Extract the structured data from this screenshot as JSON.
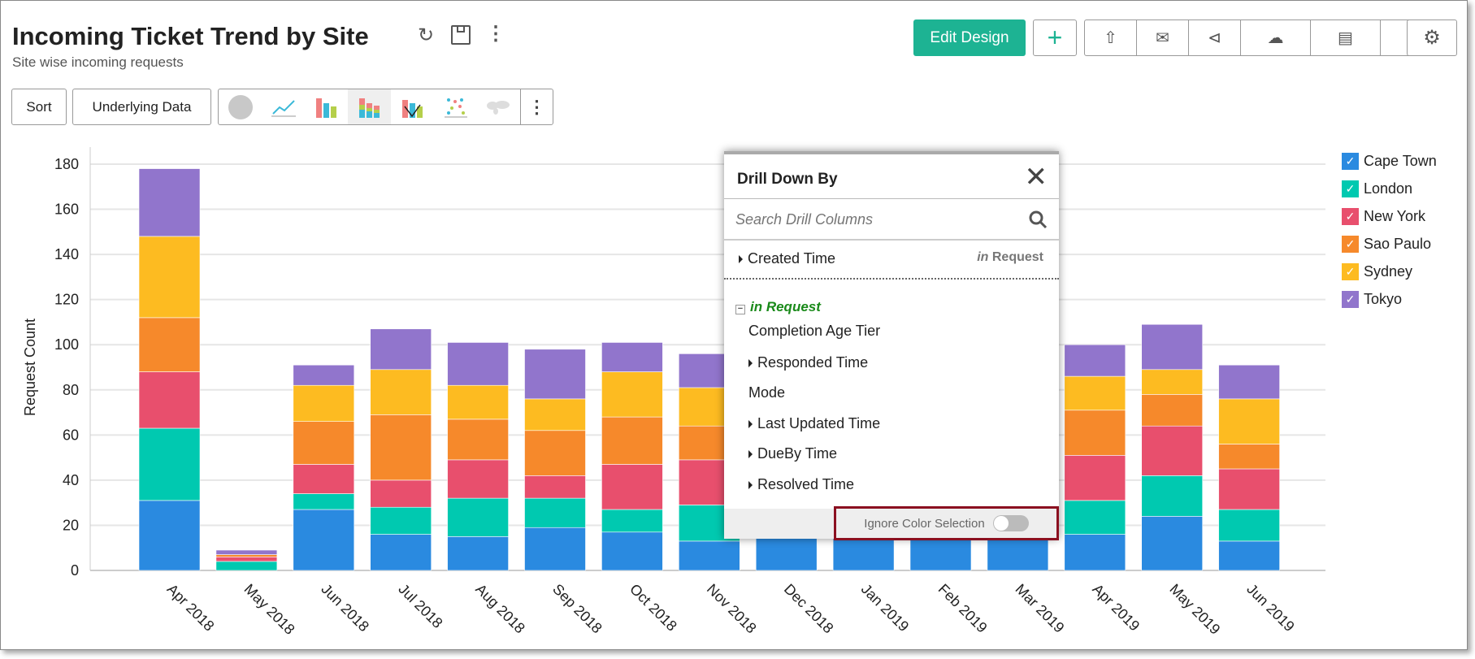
{
  "header": {
    "title": "Incoming Ticket Trend by Site",
    "subtitle": "Site wise incoming requests",
    "edit_design": "Edit Design"
  },
  "toolbar": {
    "sort": "Sort",
    "underlying_data": "Underlying Data"
  },
  "colors": {
    "Cape Town": "#2a8ae0",
    "London": "#00c9b0",
    "New York": "#e84f6d",
    "Sao Paulo": "#f6892b",
    "Sydney": "#fdbb21",
    "Tokyo": "#9175cc",
    "accent": "#1db393"
  },
  "chart_data": {
    "type": "bar",
    "stacked": true,
    "ylabel": "Request Count",
    "xlabel": "",
    "ylim": [
      0,
      180
    ],
    "yticks": [
      0,
      20,
      40,
      60,
      80,
      100,
      120,
      140,
      160,
      180
    ],
    "grid": true,
    "legend_position": "right",
    "categories": [
      "Apr 2018",
      "May 2018",
      "Jun 2018",
      "Jul 2018",
      "Aug 2018",
      "Sep 2018",
      "Oct 2018",
      "Nov 2018",
      "Dec 2018",
      "Jan 2019",
      "Feb 2019",
      "Mar 2019",
      "Apr 2019",
      "May 2019",
      "Jun 2019"
    ],
    "series": [
      {
        "name": "Cape Town",
        "values": [
          31,
          0,
          27,
          16,
          15,
          19,
          17,
          13,
          15,
          15,
          15,
          15,
          16,
          24,
          13
        ]
      },
      {
        "name": "London",
        "values": [
          32,
          4,
          7,
          12,
          17,
          13,
          10,
          16,
          12,
          12,
          12,
          12,
          15,
          18,
          14
        ]
      },
      {
        "name": "New York",
        "values": [
          25,
          2,
          13,
          12,
          17,
          10,
          20,
          20,
          18,
          18,
          18,
          18,
          20,
          22,
          18
        ]
      },
      {
        "name": "Sao Paulo",
        "values": [
          24,
          1,
          19,
          29,
          18,
          20,
          21,
          15,
          15,
          15,
          15,
          15,
          20,
          14,
          11
        ]
      },
      {
        "name": "Sydney",
        "values": [
          36,
          0,
          16,
          20,
          15,
          14,
          20,
          17,
          15,
          15,
          15,
          15,
          15,
          11,
          20
        ]
      },
      {
        "name": "Tokyo",
        "values": [
          30,
          2,
          9,
          18,
          19,
          22,
          13,
          15,
          15,
          15,
          15,
          15,
          14,
          20,
          15
        ]
      }
    ]
  },
  "popup": {
    "title": "Drill Down By",
    "search_placeholder": "Search Drill Columns",
    "created_time": "Created Time",
    "in": "in",
    "request": "Request",
    "group_label": "in Request",
    "items": [
      {
        "label": "Completion Age Tier",
        "expandable": false
      },
      {
        "label": "Responded Time",
        "expandable": true
      },
      {
        "label": "Mode",
        "expandable": false
      },
      {
        "label": "Last Updated Time",
        "expandable": true
      },
      {
        "label": "DueBy Time",
        "expandable": true
      },
      {
        "label": "Resolved Time",
        "expandable": true
      }
    ],
    "ignore_color": "Ignore Color Selection",
    "ignore_color_on": false
  }
}
